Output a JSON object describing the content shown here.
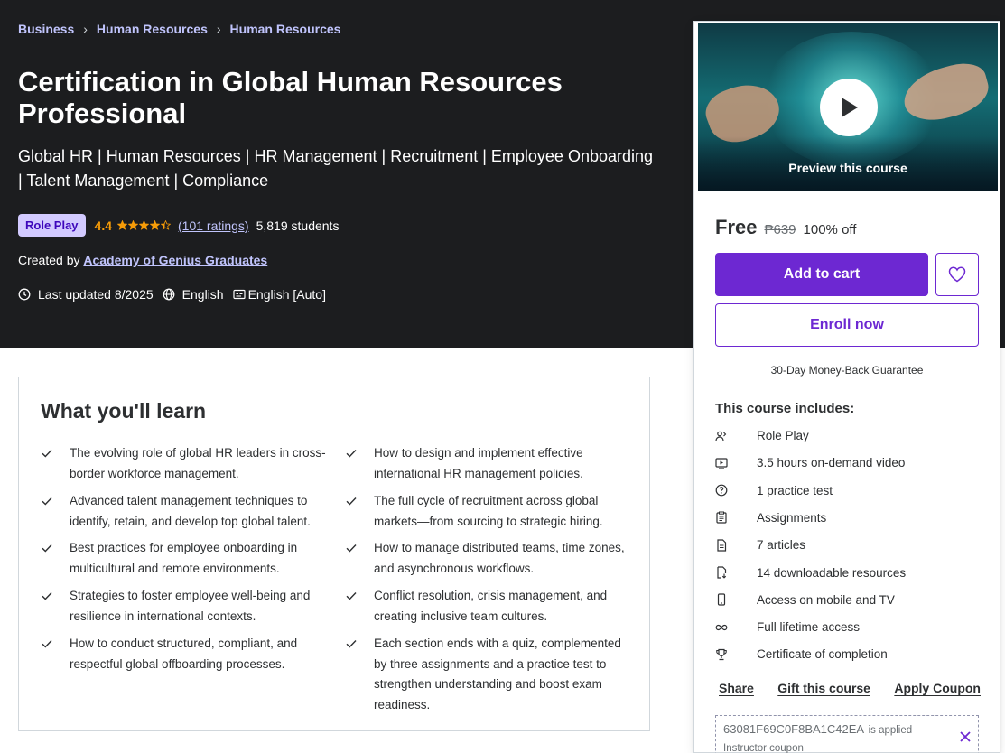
{
  "breadcrumb": [
    "Business",
    "Human Resources",
    "Human Resources"
  ],
  "course": {
    "title": "Certification in Global Human Resources Professional",
    "subtitle": "Global HR | Human Resources | HR Management | Recruitment | Employee Onboarding | Talent Management | Compliance",
    "badge": "Role Play",
    "rating": "4.4",
    "rating_stars": 4.4,
    "ratings_count": "(101 ratings)",
    "students": "5,819 students",
    "created_by_label": "Created by",
    "instructor": "Academy of Genius Graduates",
    "last_updated": "Last updated 8/2025",
    "language": "English",
    "captions": "English [Auto]"
  },
  "learn": {
    "title": "What you'll learn",
    "left": [
      "The evolving role of global HR leaders in cross-border workforce management.",
      "Advanced talent management techniques to identify, retain, and develop top global talent.",
      "Best practices for employee onboarding in multicultural and remote environments.",
      "Strategies to foster employee well-being and resilience in international contexts.",
      "How to conduct structured, compliant, and respectful global offboarding processes."
    ],
    "right": [
      "How to design and implement effective international HR management policies.",
      "The full cycle of recruitment across global markets—from sourcing to strategic hiring.",
      "How to manage distributed teams, time zones, and asynchronous workflows.",
      "Conflict resolution, crisis management, and creating inclusive team cultures.",
      "Each section ends with a quiz, complemented by three assignments and a practice test to strengthen understanding and boost exam readiness."
    ]
  },
  "card": {
    "preview_label": "Preview this course",
    "price": "Free",
    "old_price": "₱639",
    "discount": "100% off",
    "add_to_cart": "Add to cart",
    "enroll": "Enroll now",
    "guarantee": "30-Day Money-Back Guarantee",
    "includes_title": "This course includes:",
    "includes": [
      {
        "icon": "role-play-icon",
        "label": "Role Play"
      },
      {
        "icon": "video-icon",
        "label": "3.5 hours on-demand video"
      },
      {
        "icon": "question-icon",
        "label": "1 practice test"
      },
      {
        "icon": "assignment-icon",
        "label": "Assignments"
      },
      {
        "icon": "article-icon",
        "label": "7 articles"
      },
      {
        "icon": "download-icon",
        "label": "14 downloadable resources"
      },
      {
        "icon": "mobile-icon",
        "label": "Access on mobile and TV"
      },
      {
        "icon": "infinity-icon",
        "label": "Full lifetime access"
      },
      {
        "icon": "trophy-icon",
        "label": "Certificate of completion"
      }
    ],
    "share": "Share",
    "gift": "Gift this course",
    "apply_coupon": "Apply Coupon",
    "coupon_code": "63081F69C0F8BA1C42EA",
    "coupon_applied": "is applied",
    "coupon_type": "Instructor coupon"
  },
  "colors": {
    "hero_bg": "#1c1d1f",
    "accent": "#6d28d2",
    "link": "#c0c4fc",
    "star": "#f69c08",
    "badge_bg": "#d2caff"
  }
}
